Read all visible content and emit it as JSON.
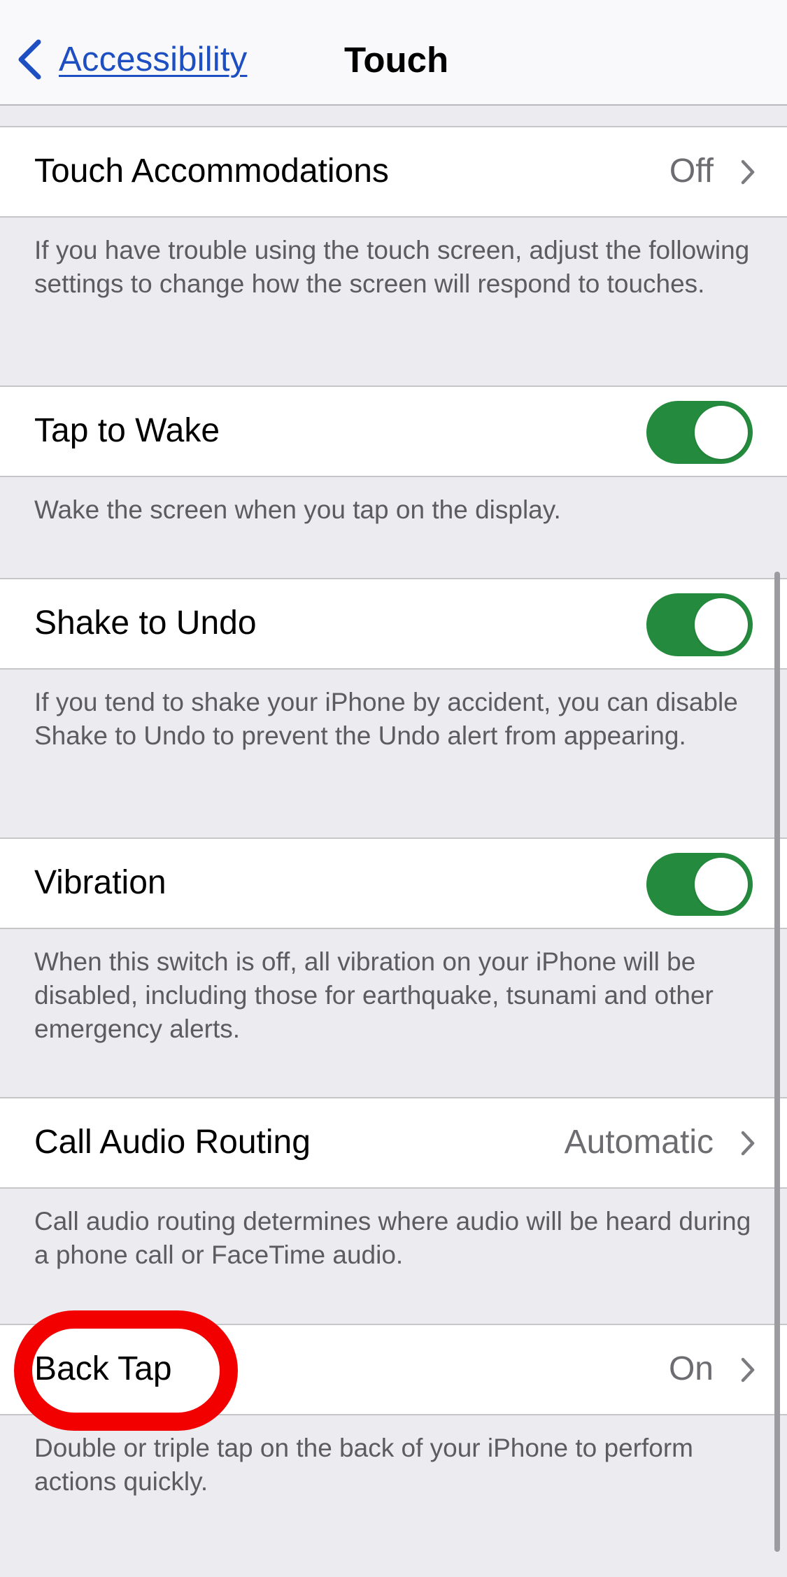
{
  "nav": {
    "back_label": "Accessibility",
    "back_icon": "chevron-left-icon",
    "title": "Touch"
  },
  "colors": {
    "accent": "#1d4fc2",
    "toggle_on": "#248a3d",
    "background": "#ebebf0",
    "annotation": "#f20000"
  },
  "settings": [
    {
      "label": "Touch Accommodations",
      "type": "disclosure",
      "value": "Off",
      "footer": "If you have trouble using the touch screen, adjust the following settings to change how the screen will respond to touches."
    },
    {
      "label": "Tap to Wake",
      "type": "toggle",
      "on": true,
      "footer": "Wake the screen when you tap on the display."
    },
    {
      "label": "Shake to Undo",
      "type": "toggle",
      "on": true,
      "footer": "If you tend to shake your iPhone by accident, you can disable Shake to Undo to prevent the Undo alert from appearing."
    },
    {
      "label": "Vibration",
      "type": "toggle",
      "on": true,
      "footer": "When this switch is off, all vibration on your iPhone will be disabled, including those for earthquake, tsunami and other emergency alerts."
    },
    {
      "label": "Call Audio Routing",
      "type": "disclosure",
      "value": "Automatic",
      "footer": "Call audio routing determines where audio will be heard during a phone call or FaceTime audio."
    },
    {
      "label": "Back Tap",
      "type": "disclosure",
      "value": "On",
      "footer": "Double or triple tap on the back of your iPhone to perform actions quickly.",
      "highlighted": true
    }
  ]
}
